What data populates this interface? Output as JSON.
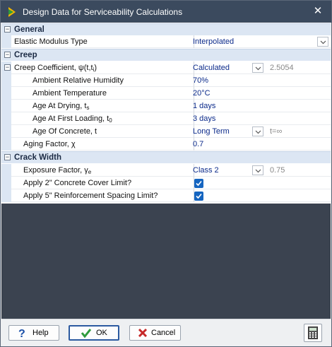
{
  "window": {
    "title": "Design Data for Serviceability Calculations",
    "close_glyph": "✕"
  },
  "categories": {
    "general": {
      "label": "General",
      "toggle": "−"
    },
    "creep": {
      "label": "Creep",
      "toggle": "−"
    },
    "crack": {
      "label": "Crack Width",
      "toggle": "−"
    }
  },
  "rows": {
    "elastic": {
      "label": "Elastic Modulus Type",
      "value": "Interpolated"
    },
    "creep_coeff": {
      "label_main": "Creep Coefficient, ψ(t,t",
      "label_sub": "i",
      "label_tail": ")",
      "toggle": "−",
      "value": "Calculated",
      "extra": "2.5054"
    },
    "humidity": {
      "label": "Ambient Relative Humidity",
      "value": "70%"
    },
    "temperature": {
      "label": "Ambient Temperature",
      "value": "20°C"
    },
    "drying": {
      "label_main": "Age At Drying, t",
      "label_sub": "s",
      "value": "1 days"
    },
    "first_loading": {
      "label_main": "Age At First Loading, t",
      "label_sub": "0",
      "value": "3 days"
    },
    "age_concrete": {
      "label": "Age Of Concrete, t",
      "value": "Long Term",
      "extra": "t=∞"
    },
    "aging": {
      "label": "Aging Factor, χ",
      "value": "0.7"
    },
    "exposure": {
      "label_main": "Exposure Factor, γ",
      "label_sub": "e",
      "value": "Class 2",
      "extra": "0.75"
    },
    "cover_limit": {
      "label": "Apply 2\" Concrete Cover Limit?",
      "checked": true
    },
    "spacing_limit": {
      "label": "Apply 5\" Reinforcement Spacing Limit?",
      "checked": true
    }
  },
  "buttons": {
    "help": "Help",
    "ok": "OK",
    "cancel": "Cancel"
  },
  "icons": {
    "app": "app-logo-icon",
    "help": "help-icon",
    "ok": "checkmark-icon",
    "cancel": "x-icon",
    "calculator": "calculator-icon"
  },
  "colors": {
    "titlebar": "#3b4a5e",
    "category": "#dce6f3",
    "value_text": "#0b2a8a",
    "checkbox": "#1565c0",
    "dark_area": "#3b4350"
  }
}
